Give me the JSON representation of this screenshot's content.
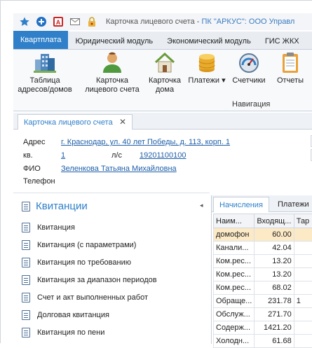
{
  "titlebar": {
    "title_prefix": "Карточка лицевого счета - ",
    "title_app": "ПК \"АРКУС\": ООО Управл"
  },
  "ribbon_tabs": [
    "Квартплата",
    "Юридический модуль",
    "Экономический модуль",
    "ГИС ЖКХ"
  ],
  "ribbon_buttons": [
    {
      "label": "Таблица\nадресов/домов",
      "icon": "buildings-icon"
    },
    {
      "label": "Карточка\nлицевого счета",
      "icon": "person-icon"
    },
    {
      "label": "Карточка\nдома",
      "icon": "house-icon"
    },
    {
      "label": "Платежи ▾",
      "icon": "coins-icon"
    },
    {
      "label": "Счетчики",
      "icon": "gauge-icon"
    },
    {
      "label": "Отчеты",
      "icon": "clipboard-icon"
    }
  ],
  "ribbon_group_label": "Навигация",
  "doc_tab": {
    "label": "Карточка лицевого счета",
    "close": "✕"
  },
  "card": {
    "address_label": "Адрес",
    "address_value": "г. Краснодар, ул. 40 лет Победы, д. 113, корп. 1",
    "apt_label": "кв.",
    "apt_value": "1",
    "account_label": "л/с",
    "account_value": "19201100100",
    "fio_label": "ФИО",
    "fio_value": "Зеленкова Татьяна Михайловна",
    "phone_label": "Телефон"
  },
  "left_panel": {
    "title": "Квитанции",
    "items": [
      "Квитанция",
      "Квитанция (с параметрами)",
      "Квитанция по требованию",
      "Квитанция за диапазон периодов",
      "Счет и акт выполненных работ",
      "Долговая квитанция",
      "Квитанция по пени"
    ]
  },
  "grid": {
    "tabs": [
      "Начисления",
      "Платежи"
    ],
    "columns": [
      "Наим...",
      "Входящ...",
      "Тар"
    ],
    "rows": [
      {
        "name": "домофон",
        "in": "60.00",
        "t": ""
      },
      {
        "name": "Канали...",
        "in": "42.04",
        "t": ""
      },
      {
        "name": "Ком.рес...",
        "in": "13.20",
        "t": ""
      },
      {
        "name": "Ком.рес...",
        "in": "13.20",
        "t": ""
      },
      {
        "name": "Ком.рес...",
        "in": "68.02",
        "t": ""
      },
      {
        "name": "Обраще...",
        "in": "231.78",
        "t": "1"
      },
      {
        "name": "Обслуж...",
        "in": "271.70",
        "t": ""
      },
      {
        "name": "Содерж...",
        "in": "1421.20",
        "t": ""
      },
      {
        "name": "Холодн...",
        "in": "61.68",
        "t": ""
      }
    ]
  },
  "colors": {
    "accent": "#2f80c9",
    "link": "#1f5fa8",
    "selected_row": "#fce9c6"
  }
}
